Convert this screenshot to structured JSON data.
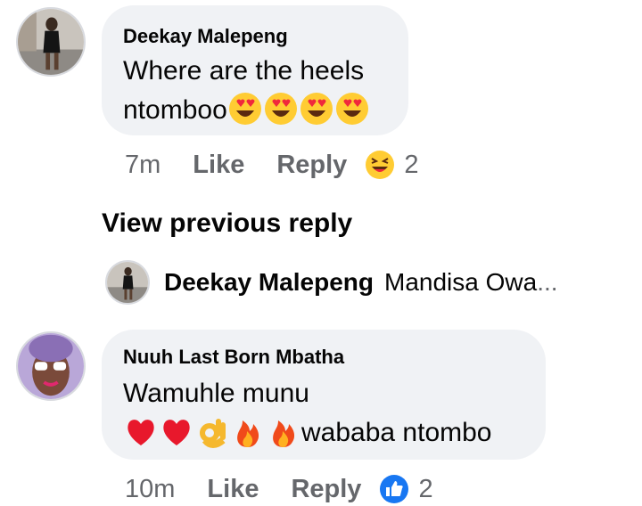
{
  "comments": [
    {
      "author": "Deekay Malepeng",
      "line1": "Where are the heels",
      "line2": "ntomboo",
      "line2_emojis": [
        "heart-eyes",
        "heart-eyes",
        "heart-eyes",
        "heart-eyes"
      ],
      "time": "7m",
      "like_label": "Like",
      "reply_label": "Reply",
      "reaction": "laughing",
      "reaction_count": "2"
    },
    {
      "author": "Nuuh Last Born Mbatha",
      "line1": "Wamuhle munu",
      "line2_emojis": [
        "red-heart",
        "red-heart",
        "ok-hand",
        "fire",
        "fire"
      ],
      "line2": "wababa ntombo",
      "time": "10m",
      "like_label": "Like",
      "reply_label": "Reply",
      "reaction": "like",
      "reaction_count": "2"
    }
  ],
  "view_previous_label": "View previous reply",
  "collapsed_reply": {
    "author": "Deekay Malepeng",
    "snippet": "Mandisa Owa",
    "ellipsis": "..."
  },
  "colors": {
    "bubble": "#f0f2f5",
    "meta": "#65676b",
    "like_blue": "#1877f2",
    "text": "#050505"
  }
}
